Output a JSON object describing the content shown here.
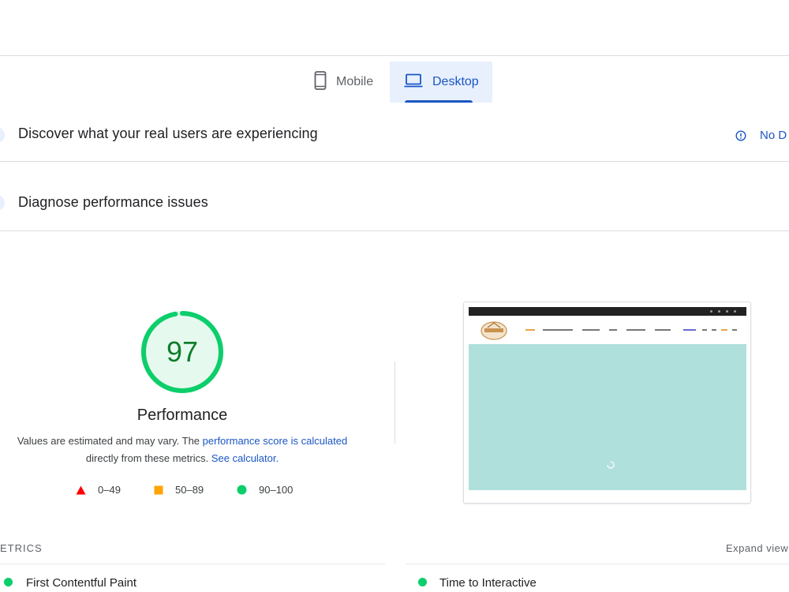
{
  "tabs": [
    {
      "label": "Mobile",
      "icon": "smartphone-icon",
      "active": false
    },
    {
      "label": "Desktop",
      "icon": "laptop-icon",
      "active": true
    }
  ],
  "sections": {
    "field_data": {
      "title": "Discover what your real users are experiencing",
      "status": "No D",
      "status_icon": "info-icon"
    },
    "lab_data": {
      "title": "Diagnose performance issues"
    }
  },
  "performance": {
    "score": "97",
    "score_fraction": 0.97,
    "label": "Performance",
    "desc_prefix": "Values are estimated and may vary. The ",
    "desc_link": "performance score is calculated",
    "desc_middle": "directly from these metrics. ",
    "desc_link2": "See calculator."
  },
  "legend": [
    {
      "range": "0–49",
      "shape": "triangle",
      "color": "#ff0000"
    },
    {
      "range": "50–89",
      "shape": "square",
      "color": "#ffa400"
    },
    {
      "range": "90–100",
      "shape": "circle",
      "color": "#0cce6b"
    }
  ],
  "metrics": {
    "header": "ETRICS",
    "expand": "Expand view",
    "items": [
      {
        "name": "First Contentful Paint",
        "status_color": "#0cce6b"
      },
      {
        "name": "Time to Interactive",
        "status_color": "#0cce6b"
      }
    ]
  },
  "colors": {
    "accent": "#1a56c4",
    "pass": "#0cce6b",
    "pass_text": "#0d7d2c",
    "hero": "#b0e0dc"
  }
}
